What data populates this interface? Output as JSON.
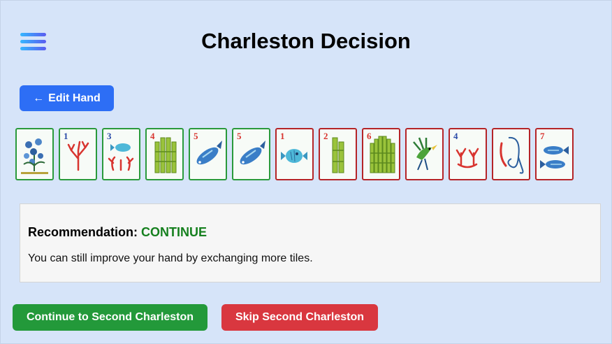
{
  "header": {
    "title": "Charleston Decision",
    "menu_icon": "hamburger-menu-icon"
  },
  "nav": {
    "edit_hand_arrow": "←",
    "edit_hand_label": "Edit Hand",
    "button_color": "#2d6ef5"
  },
  "hand": {
    "kept_border_color": "#2a9a3c",
    "discard_border_color": "#b52428",
    "tiles": [
      {
        "kind": "flower",
        "number": "",
        "status": "keep",
        "icon": "flower-plant-icon"
      },
      {
        "kind": "coral",
        "number": "1",
        "status": "keep",
        "icon": "coral-icon"
      },
      {
        "kind": "coral-fish",
        "number": "3",
        "status": "keep",
        "icon": "coral-fish-icon"
      },
      {
        "kind": "bamboo",
        "number": "4",
        "status": "keep",
        "icon": "bamboo-icon"
      },
      {
        "kind": "fish",
        "number": "5",
        "status": "keep",
        "icon": "fish-icon"
      },
      {
        "kind": "fish",
        "number": "5",
        "status": "keep",
        "icon": "fish-icon"
      },
      {
        "kind": "fish-round",
        "number": "1",
        "status": "discard",
        "icon": "round-fish-icon"
      },
      {
        "kind": "bamboo",
        "number": "2",
        "status": "discard",
        "icon": "bamboo-icon"
      },
      {
        "kind": "bamboo",
        "number": "6",
        "status": "discard",
        "icon": "bamboo-icon"
      },
      {
        "kind": "bird",
        "number": "",
        "status": "discard",
        "icon": "bird-icon"
      },
      {
        "kind": "coral",
        "number": "4",
        "status": "discard",
        "icon": "coral-icon"
      },
      {
        "kind": "fishing-hook",
        "number": "",
        "status": "discard",
        "icon": "fishing-hook-icon"
      },
      {
        "kind": "two-fish",
        "number": "7",
        "status": "discard",
        "icon": "two-fish-icon"
      }
    ]
  },
  "recommendation": {
    "label": "Recommendation:",
    "value": "CONTINUE",
    "value_color": "#16801f",
    "description": "You can still improve your hand by exchanging more tiles."
  },
  "actions": {
    "continue_label": "Continue to Second Charleston",
    "continue_color": "#23993a",
    "skip_label": "Skip Second Charleston",
    "skip_color": "#d9373f"
  }
}
